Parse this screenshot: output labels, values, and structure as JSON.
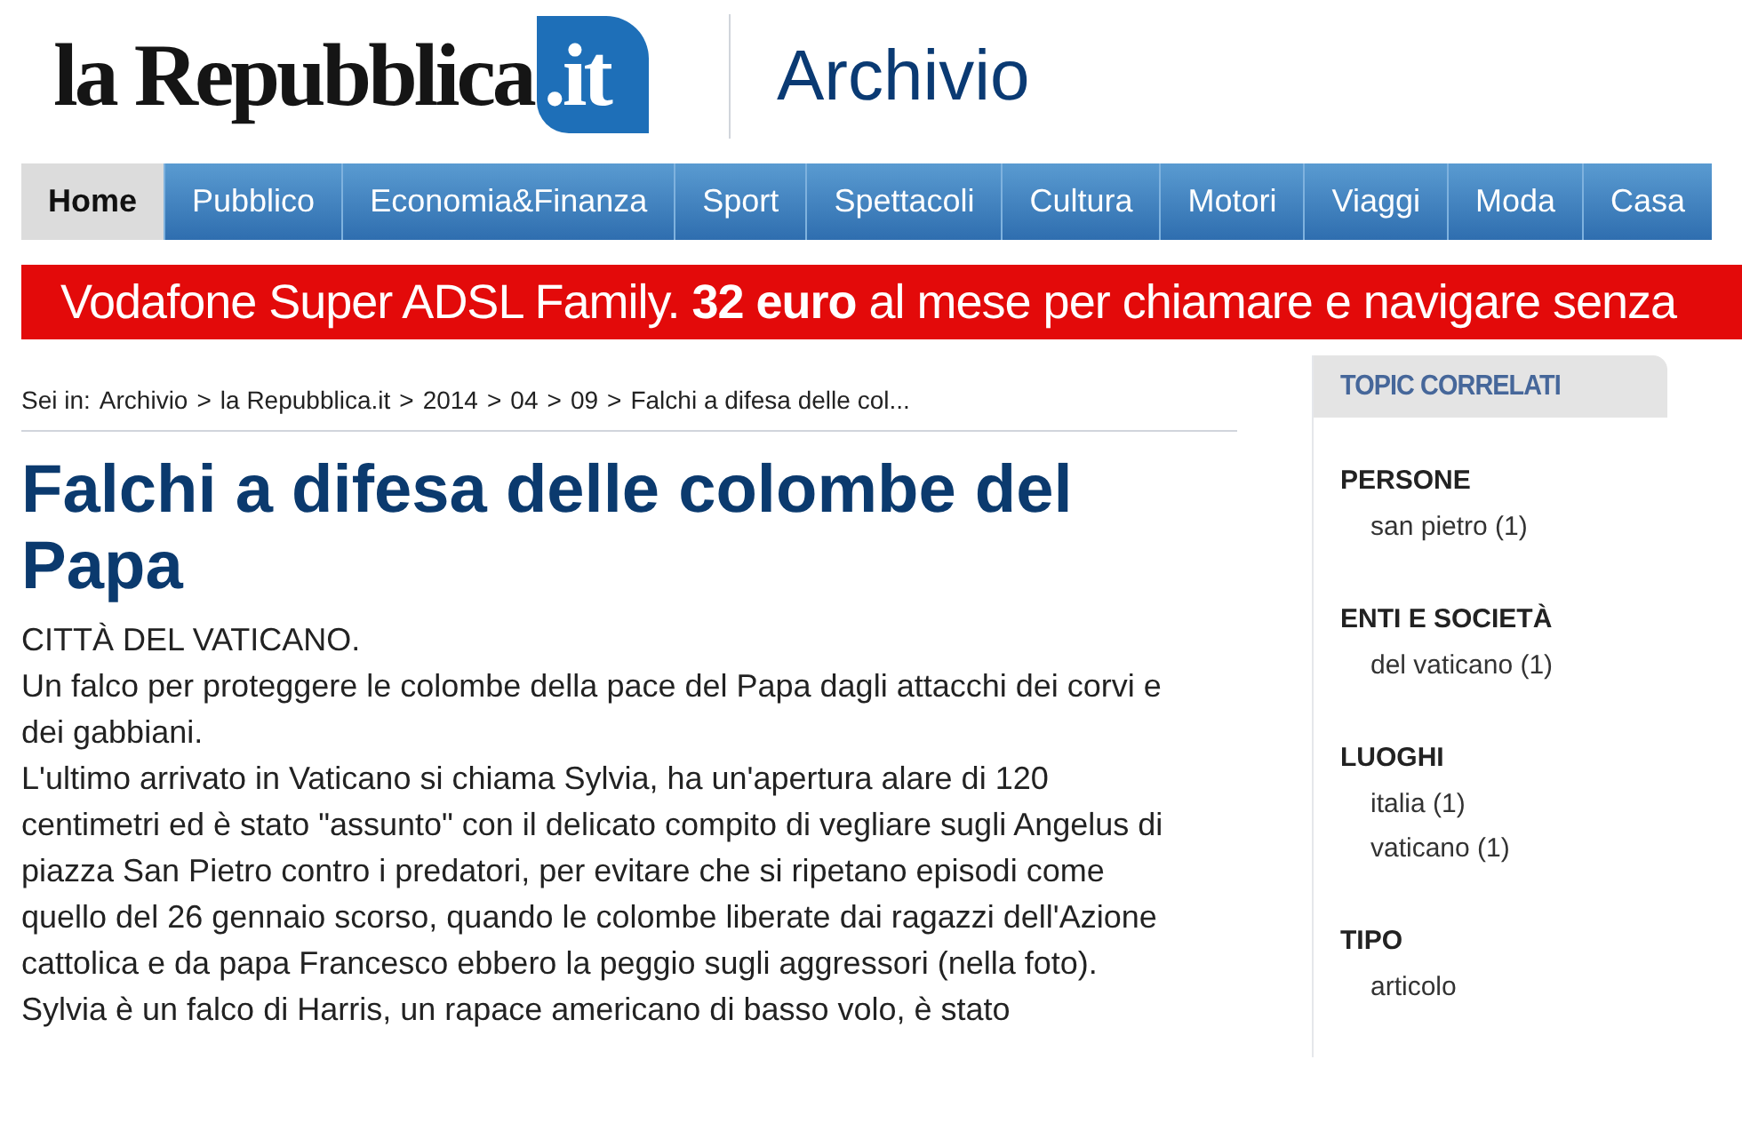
{
  "header": {
    "logo": {
      "name": "la Repubblica",
      "suffix": ".it"
    },
    "section": "Archivio"
  },
  "nav": [
    {
      "label": "Home",
      "selected": true
    },
    {
      "label": "Pubblico",
      "selected": false
    },
    {
      "label": "Economia&Finanza",
      "selected": false
    },
    {
      "label": "Sport",
      "selected": false
    },
    {
      "label": "Spettacoli",
      "selected": false
    },
    {
      "label": "Cultura",
      "selected": false
    },
    {
      "label": "Motori",
      "selected": false
    },
    {
      "label": "Viaggi",
      "selected": false
    },
    {
      "label": "Moda",
      "selected": false
    },
    {
      "label": "Casa",
      "selected": false
    }
  ],
  "banner": "Vodafone  Super ADSL Family. **32 euro** al mese per chiamare e navigare senza",
  "breadcrumb": {
    "prefix": "Sei in:",
    "separator": ">",
    "items": [
      "Archivio",
      "la Repubblica.it",
      "2014",
      "04",
      "09",
      "Falchi a difesa delle col..."
    ]
  },
  "article": {
    "title": "Falchi a difesa delle colombe del Papa",
    "paragraphs": [
      "CITTÀ DEL VATICANO.",
      "Un falco per proteggere le colombe della pace del Papa dagli attacchi dei corvi e dei gabbiani.",
      "L'ultimo arrivato in Vaticano si chiama Sylvia, ha un'apertura alare di 120 centimetri ed è stato \"assunto\" con il delicato compito di vegliare sugli Angelus di piazza San Pietro contro i predatori, per evitare che si ripetano episodi come quello del 26 gennaio scorso, quando le colombe liberate dai ragazzi dell'Azione cattolica e da papa Francesco ebbero la peggio sugli aggressori (nella foto).",
      "Sylvia è un falco di Harris, un rapace americano di basso volo, è stato"
    ]
  },
  "sidebar": {
    "title": "TOPIC CORRELATI",
    "groups": [
      {
        "heading": "PERSONE",
        "items": [
          "san pietro (1)"
        ]
      },
      {
        "heading": "ENTI E SOCIETÀ",
        "items": [
          "del vaticano (1)"
        ]
      },
      {
        "heading": "LUOGHI",
        "items": [
          "italia (1)",
          "vaticano (1)"
        ]
      },
      {
        "heading": "TIPO",
        "items": [
          "articolo"
        ]
      }
    ]
  }
}
